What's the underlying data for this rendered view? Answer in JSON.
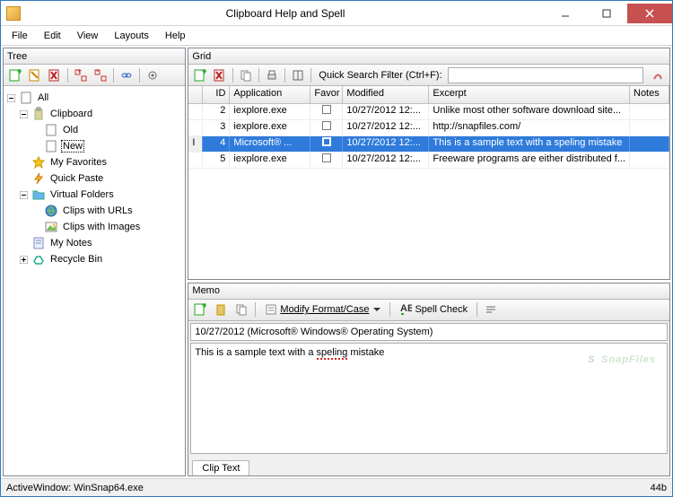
{
  "window": {
    "title": "Clipboard Help and Spell"
  },
  "menu": {
    "file": "File",
    "edit": "Edit",
    "view": "View",
    "layouts": "Layouts",
    "help": "Help"
  },
  "tree": {
    "header": "Tree",
    "root": "All",
    "clipboard": "Clipboard",
    "old": "Old",
    "new": "New",
    "favorites": "My Favorites",
    "quickpaste": "Quick Paste",
    "vfolders": "Virtual Folders",
    "vf_urls": "Clips with URLs",
    "vf_images": "Clips with Images",
    "notes": "My Notes",
    "recycle": "Recycle Bin"
  },
  "grid": {
    "header": "Grid",
    "filter_label": "Quick Search Filter (Ctrl+F):",
    "col_id": "ID",
    "col_app": "Application",
    "col_fav": "Favor",
    "col_mod": "Modified",
    "col_exc": "Excerpt",
    "col_notes": "Notes",
    "rows": [
      {
        "id": "2",
        "app": "iexplore.exe",
        "mod": "10/27/2012 12:...",
        "exc": "Unlike most other software download site..."
      },
      {
        "id": "3",
        "app": "iexplore.exe",
        "mod": "10/27/2012 12:...",
        "exc": "http://snapfiles.com/"
      },
      {
        "id": "4",
        "app": "Microsoft® ...",
        "mod": "10/27/2012 12:...",
        "exc": "This is a sample text with a speling mistake"
      },
      {
        "id": "5",
        "app": "iexplore.exe",
        "mod": "10/27/2012 12:...",
        "exc": "Freeware programs are either distributed f..."
      }
    ]
  },
  "memo": {
    "header": "Memo",
    "modify": "Modify Format/Case",
    "spell": "Spell Check",
    "title": "10/27/2012 (Microsoft® Windows® Operating System)",
    "body_pre": "This is a sample text with a ",
    "body_err": "speling",
    "body_post": " mistake",
    "tab": "Clip Text"
  },
  "status": {
    "left": "ActiveWindow: WinSnap64.exe",
    "right": "44b"
  },
  "watermark": "SnapFiles"
}
